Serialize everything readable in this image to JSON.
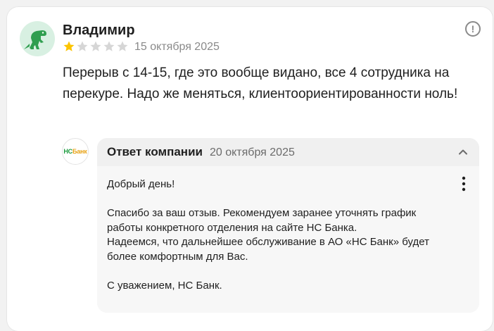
{
  "review": {
    "author": "Владимир",
    "avatar_icon": "dinosaur-avatar-icon",
    "rating": 1,
    "max_rating": 5,
    "date": "15 октября 2025",
    "text": "Перерыв с 14-15, где это вообще видано, все 4 сотрудника на перекуре. Надо же меняться, клиентоориентированности ноль!",
    "more_icon": "exclamation-circle-icon"
  },
  "reply": {
    "logo_text_green": "НС",
    "logo_text_orange": "Банк",
    "title": "Ответ компании",
    "date": "20 октября 2025",
    "text": "Добрый день!\n\nСпасибо за ваш отзыв. Рекомендуем заранее уточнять график работы конкретного отделения на сайте НС Банка.\nНадеемся, что дальнейшее обслуживание в АО «НС Банк» будет более комфортным для Вас.\n\nС уважением, НС Банк.",
    "collapse_icon": "chevron-up-icon",
    "menu_icon": "kebab-menu-icon"
  },
  "colors": {
    "star_filled": "#fcc400",
    "star_empty": "#d6d6d6",
    "logo_green": "#1a9a3d",
    "logo_orange": "#e8a317"
  }
}
